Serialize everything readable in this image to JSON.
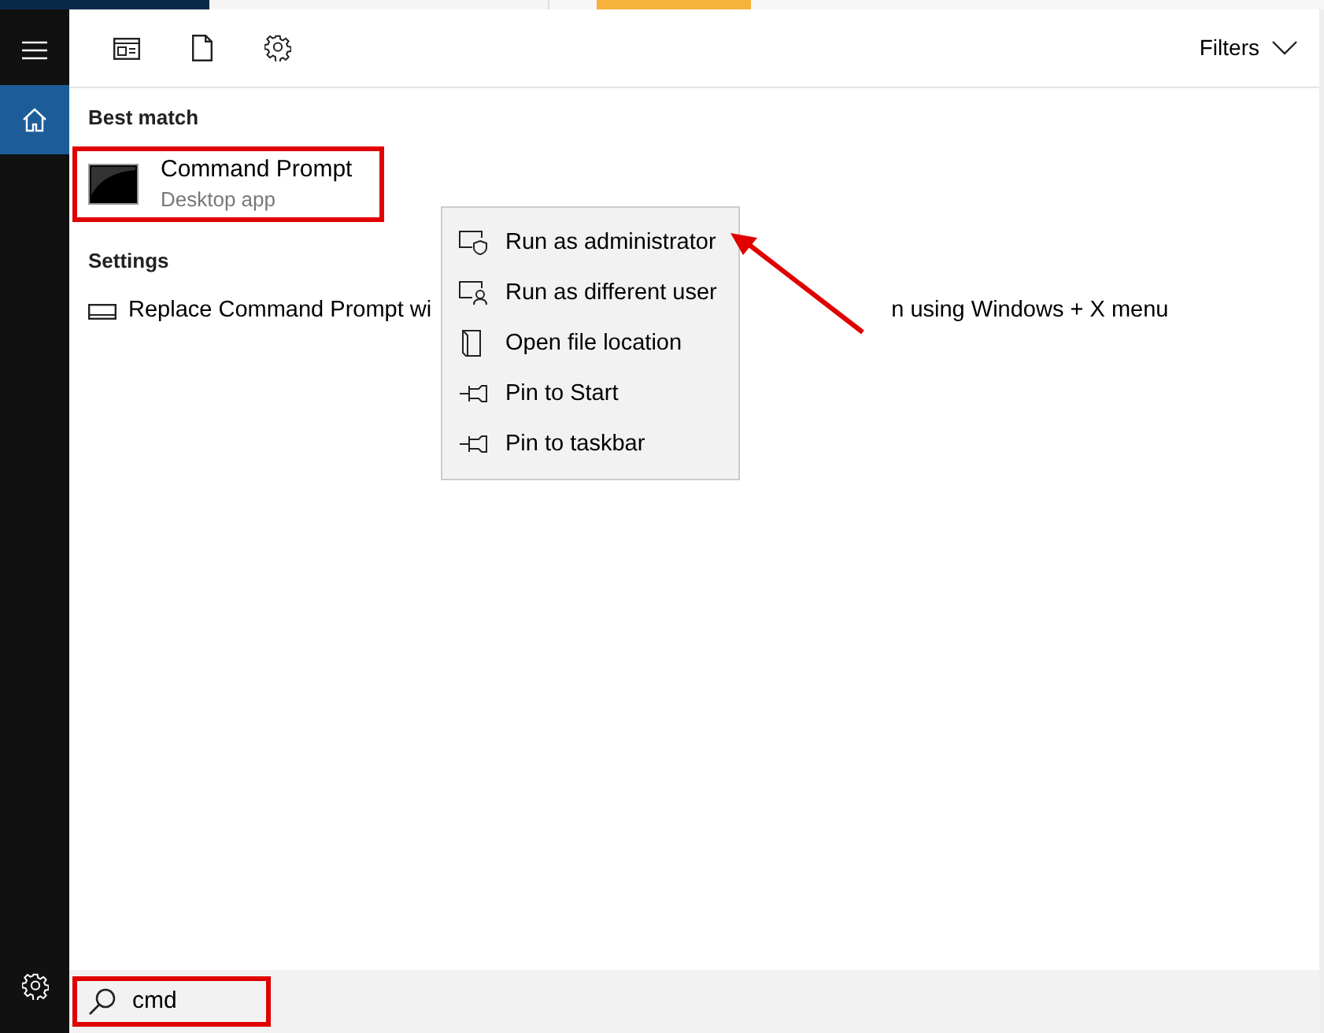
{
  "sidebar": {
    "items": [
      {
        "kind": "menu",
        "selected": false
      },
      {
        "kind": "home",
        "selected": true
      }
    ],
    "footer": [
      {
        "kind": "settings"
      }
    ]
  },
  "toolbar": {
    "icons": [
      {
        "kind": "apps"
      },
      {
        "kind": "documents"
      },
      {
        "kind": "settings"
      }
    ],
    "filters": "Filters"
  },
  "sections": [
    {
      "heading": "Best match",
      "items": [
        {
          "kind": "app",
          "title": "Command Prompt",
          "subtitle": "Desktop app",
          "highlighted": true
        }
      ]
    },
    {
      "heading": "Settings",
      "items": [
        {
          "kind": "setting",
          "title_start": "Replace Command Prompt wi",
          "title_end": "n using Windows + X menu"
        }
      ]
    }
  ],
  "context_menu": {
    "items": [
      {
        "kind": "shield",
        "label": "Run as administrator",
        "pointed": true
      },
      {
        "kind": "user",
        "label": "Run as different user",
        "pointed": false
      },
      {
        "kind": "folder",
        "label": "Open file location",
        "pointed": false
      },
      {
        "kind": "pin",
        "label": "Pin to Start",
        "pointed": false
      },
      {
        "kind": "pin",
        "label": "Pin to taskbar",
        "pointed": false
      }
    ]
  },
  "search": {
    "value": "cmd",
    "highlighted": true
  }
}
